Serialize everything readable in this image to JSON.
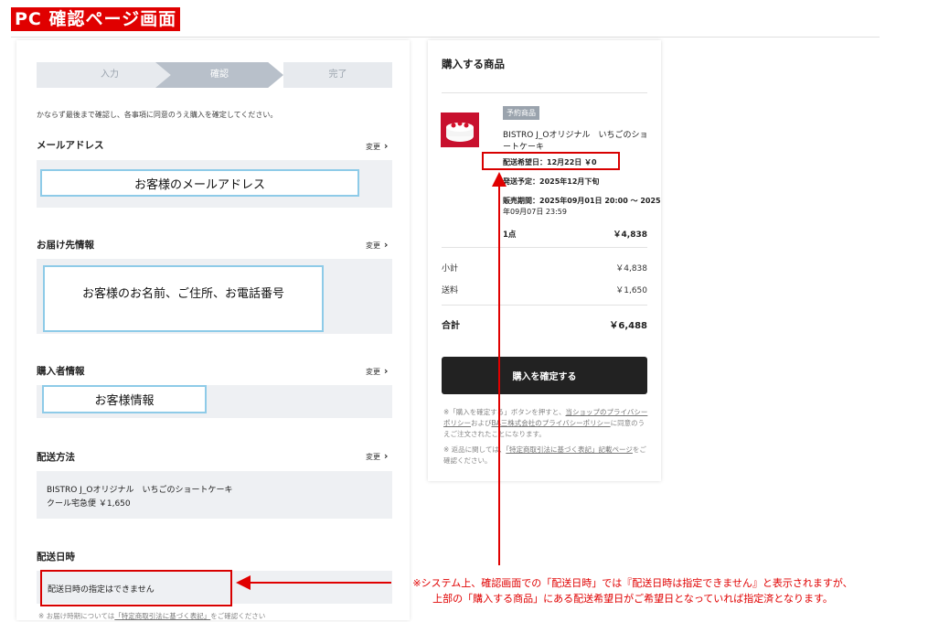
{
  "page_label": "PC 確認ページ画面",
  "stepper": {
    "step1": "入力",
    "step2": "確認",
    "step3": "完了"
  },
  "notice": "かならず最後まで確認し、各事項に同意のうえ購入を確定してください。",
  "sections": {
    "email": {
      "title": "メールアドレス",
      "change": "変更",
      "placeholder": "お客様のメールアドレス"
    },
    "delivery": {
      "title": "お届け先情報",
      "change": "変更",
      "placeholder": "お客様のお名前、ご住所、お電話番号"
    },
    "buyer": {
      "title": "購入者情報",
      "change": "変更",
      "placeholder": "お客様情報"
    },
    "shipping": {
      "title": "配送方法",
      "change": "変更",
      "line1": "BISTRO J_Oオリジナル　いちごのショートケーキ",
      "line2": "クール宅急便 ￥1,650"
    },
    "datetime": {
      "title": "配送日時",
      "value": "配送日時の指定はできません",
      "footnote_prefix": "※ お届け時期については",
      "footnote_link": "「特定商取引法に基づく表記」",
      "footnote_suffix": "をご確認ください"
    }
  },
  "order": {
    "title": "購入する商品",
    "badge": "予約商品",
    "product_name": "BISTRO J_Oオリジナル　いちごのショートケーキ",
    "delivery_wish": "配送希望日：12月22日 ￥0",
    "ship_plan": "発送予定：2025年12月下旬",
    "sale_period_l1": "販売期間：2025年09月01日 20:00 〜 2025",
    "sale_period_l2": "年09月07日 23:59",
    "qty": "1点",
    "item_price": "￥4,838",
    "subtotal_label": "小計",
    "subtotal": "￥4,838",
    "shipping_label": "送料",
    "shipping_fee": "￥1,650",
    "total_label": "合計",
    "total": "￥6,488",
    "confirm_button": "購入を確定する",
    "legal1_a": "※「購入を確定する」ボタンを押すと、",
    "legal1_link1": "当ショップのプライバシーポリシー",
    "legal1_b": "および",
    "legal1_link2": "BA三株式会社のプライバシーポリシー",
    "legal1_c": "に同意のうえご注文されたことになります。",
    "legal2_a": "※ 返品に関しては、",
    "legal2_link": "「特定商取引法に基づく表記」記載ページ",
    "legal2_b": "をご確認ください。"
  },
  "annotation": {
    "line1": "※システム上、確認画面での「配送日時」では『配送日時は指定できません』と表示されますが、",
    "line2": "上部の「購入する商品」にある配送希望日がご希望日となっていれば指定済となります。",
    "color": "#e00000"
  }
}
